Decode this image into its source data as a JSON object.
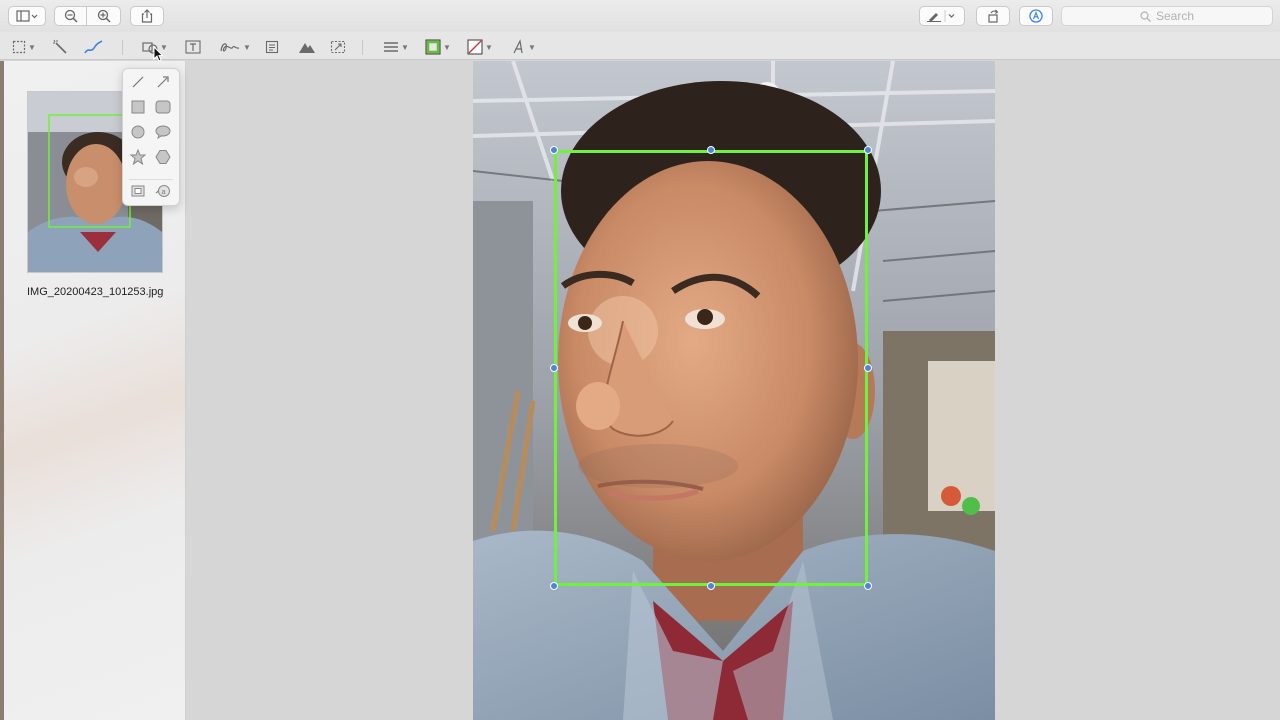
{
  "toolbar": {
    "search_placeholder": "Search",
    "buttons": [
      "sidebar-toggle",
      "zoom-out",
      "zoom-in",
      "share",
      "markup-pen",
      "rotate",
      "markup-mode"
    ]
  },
  "markup_tools": [
    "rectangular-selection",
    "instant-alpha",
    "sketch",
    "shapes",
    "text",
    "sign",
    "note",
    "adjust-color",
    "adjust-size",
    "shape-style",
    "border-color",
    "fill-color",
    "text-style"
  ],
  "shapes_popover": {
    "items": [
      "line",
      "arrow",
      "rectangle",
      "rounded-rectangle",
      "oval",
      "speech-bubble",
      "star",
      "hexagon",
      "mask",
      "loupe"
    ]
  },
  "sidebar": {
    "thumbnail": {
      "filename": "IMG_20200423_101253.jpg"
    }
  },
  "colors": {
    "selection_border": "#6ff23b",
    "handle": "#4b86d8",
    "canvas_bg": "#d6d6d6"
  }
}
